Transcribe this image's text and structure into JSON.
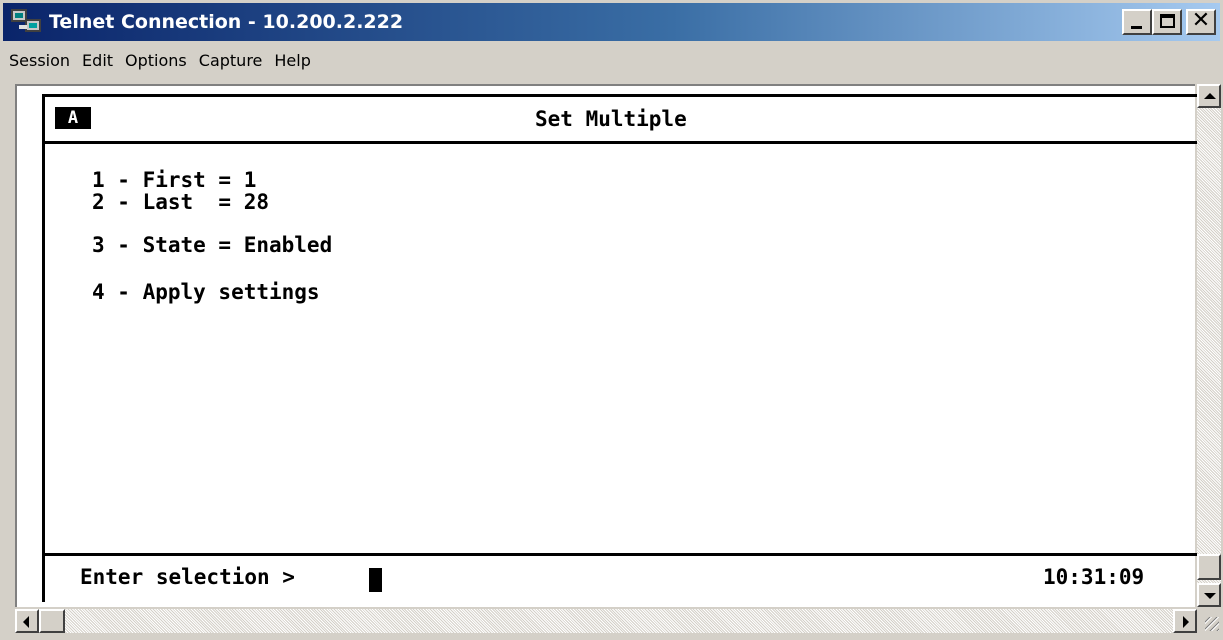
{
  "window": {
    "title": "Telnet Connection - 10.200.2.222",
    "app_icon": "telnet-computers-icon",
    "controls": [
      "minimize",
      "maximize",
      "close"
    ]
  },
  "menu": {
    "items": [
      "Session",
      "Edit",
      "Options",
      "Capture",
      "Help"
    ]
  },
  "terminal": {
    "indicator": "A",
    "screen_title": "Set Multiple",
    "lines": [
      "1 - First = 1",
      "2 - Last  = 28",
      "3 - State = Enabled",
      "4 - Apply settings"
    ],
    "prompt": "Enter selection >",
    "clock": "10:31:09"
  },
  "colors": {
    "titlebar_start": "#0a246a",
    "titlebar_end": "#a6caf0",
    "chrome": "#d4d0c8",
    "terminal_bg": "#ffffff",
    "terminal_fg": "#000000"
  }
}
